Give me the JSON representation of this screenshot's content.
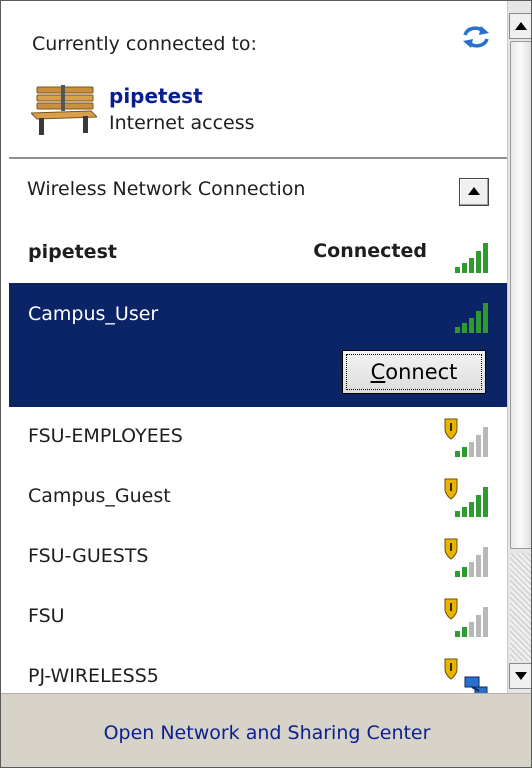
{
  "current": {
    "heading": "Currently connected to:",
    "network_name": "pipetest",
    "access": "Internet access",
    "refresh_icon": "refresh-arrows-icon",
    "network_icon": "bench-icon"
  },
  "wireless": {
    "header": "Wireless Network Connection",
    "collapse_icon": "up-arrow-icon",
    "connected": {
      "name": "pipetest",
      "status": "Connected",
      "signal_bars": 5,
      "secured": false
    },
    "selected": {
      "name": "Campus_User",
      "signal_bars": 5,
      "secured": false,
      "connect_label_accel": "C",
      "connect_label_rest": "onnect"
    },
    "networks": [
      {
        "name": "FSU-EMPLOYEES",
        "signal_bars": 2,
        "secured": true
      },
      {
        "name": "Campus_Guest",
        "signal_bars": 5,
        "secured": true
      },
      {
        "name": "FSU-GUESTS",
        "signal_bars": 2,
        "secured": true
      },
      {
        "name": "FSU",
        "signal_bars": 2,
        "secured": true
      },
      {
        "name": "PJ-WIRELESS5",
        "signal_bars": 0,
        "secured": true,
        "adhoc": true
      }
    ]
  },
  "footer": {
    "link": "Open Network and Sharing Center"
  },
  "colors": {
    "selected_bg": "#0a2466",
    "link": "#0a1f8f",
    "signal_on": "#2f9a2f",
    "signal_off": "#b8b8b8",
    "footer_bg": "#d8d3c8"
  }
}
